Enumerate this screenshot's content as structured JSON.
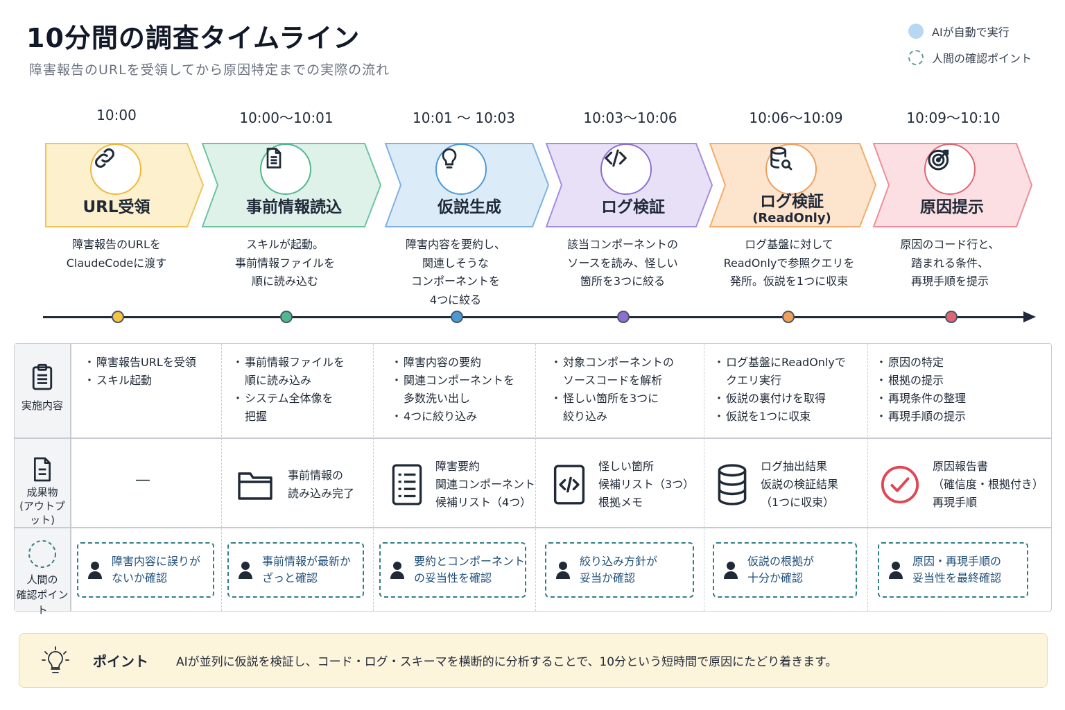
{
  "header": {
    "title": "10分間の調査タイムライン",
    "subtitle": "障害報告のURLを受領してから原因特定までの実際の流れ"
  },
  "legend": {
    "ai_label": "AIが自動で実行",
    "human_label": "人間の確認ポイント"
  },
  "colors": {
    "step1": "#f6c343",
    "step2": "#4fb890",
    "step3": "#4a9ad8",
    "step4": "#8b6fd1",
    "step5": "#f0a05a",
    "step6": "#e06572",
    "check": "#2f7f86",
    "timeline": "#1f2937"
  },
  "steps": [
    {
      "time": "10:00",
      "label": "URL受領",
      "sublabel": "",
      "icon": "link-icon",
      "desc": [
        "障害報告のURLを",
        "ClaudeCodeに渡す"
      ]
    },
    {
      "time": "10:00～10:01",
      "label": "事前情報読込",
      "sublabel": "",
      "icon": "document-icon",
      "desc": [
        "スキルが起動。",
        "事前情報ファイルを",
        "順に読み込む"
      ]
    },
    {
      "time": "10:01 ～ 10:03",
      "label": "仮説生成",
      "sublabel": "",
      "icon": "lightbulb-icon",
      "desc": [
        "障害内容を要約し、",
        "関連しそうな",
        "コンポーネントを",
        "4つに絞る"
      ]
    },
    {
      "time": "10:03～10:06",
      "label": "ログ検証",
      "sublabel": "",
      "icon": "code-icon",
      "desc": [
        "該当コンポーネントの",
        "ソースを読み、怪しい",
        "箇所を3つに絞る"
      ]
    },
    {
      "time": "10:06～10:09",
      "label": "ログ検証",
      "sublabel": "(ReadOnly)",
      "icon": "database-search-icon",
      "desc": [
        "ログ基盤に対して",
        "ReadOnlyで参照クエリを",
        "発所。仮説を1つに収束"
      ]
    },
    {
      "time": "10:09～10:10",
      "label": "原因提示",
      "sublabel": "",
      "icon": "target-icon",
      "desc": [
        "原因のコード行と、",
        "踏まれる条件、",
        "再現手順を提示"
      ]
    }
  ],
  "table": {
    "row_headers": {
      "activities": "実施内容",
      "deliverables": [
        "成果物",
        "(アウトプット)"
      ],
      "checkpoints": [
        "人間の",
        "確認ポイント"
      ]
    },
    "activities": [
      [
        "障害報告URLを受領",
        "スキル起動"
      ],
      [
        "事前情報ファイルを",
        "順に読み込み",
        "システム全体像を",
        "把握"
      ],
      [
        "障害内容の要約",
        "関連コンポーネントを",
        "多数洗い出し",
        "4つに絞り込み"
      ],
      [
        "対象コンポーネントの",
        "ソースコードを解析",
        "怪しい箇所を3つに",
        "絞り込み"
      ],
      [
        "ログ基盤にReadOnlyで",
        "クエリ実行",
        "仮説の裏付けを取得",
        "仮説を1つに収束"
      ],
      [
        "原因の特定",
        "根拠の提示",
        "再現条件の整理",
        "再現手順の提示"
      ]
    ],
    "deliverables": [
      {
        "icon": "",
        "lines": [
          "—"
        ]
      },
      {
        "icon": "folder-icon",
        "lines": [
          "事前情報の",
          "読み込み完了"
        ]
      },
      {
        "icon": "list-document-icon",
        "lines": [
          "障害要約",
          "関連コンポーネント",
          "候補リスト（4つ）"
        ]
      },
      {
        "icon": "code-file-icon",
        "lines": [
          "怪しい箇所",
          "候補リスト（3つ）",
          "根拠メモ"
        ]
      },
      {
        "icon": "database-icon",
        "lines": [
          "ログ抽出結果",
          "仮説の検証結果",
          "（1つに収束）"
        ]
      },
      {
        "icon": "check-circle-icon",
        "lines": [
          "原因報告書",
          "（確信度・根拠付き）",
          "再現手順"
        ]
      }
    ],
    "checkpoints": [
      [
        "障害内容に誤りが",
        "ないか確認"
      ],
      [
        "事前情報が最新か",
        "ざっと確認"
      ],
      [
        "要約とコンポーネント",
        "の妥当性を確認"
      ],
      [
        "絞り込み方針が",
        "妥当か確認"
      ],
      [
        "仮説の根拠が",
        "十分か確認"
      ],
      [
        "原因・再現手順の",
        "妥当性を最終確認"
      ]
    ]
  },
  "point": {
    "label": "ポイント",
    "text": "AIが並列に仮説を検証し、コード・ログ・スキーマを横断的に分析することで、10分という短時間で原因にたどり着きます。"
  }
}
